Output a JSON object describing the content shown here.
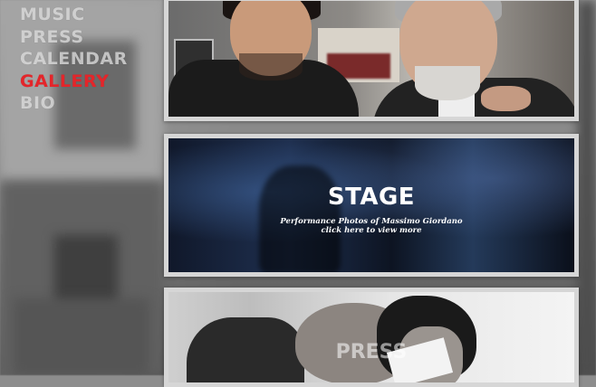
{
  "nav": {
    "items": [
      {
        "label": "MUSIC"
      },
      {
        "label": "PRESS"
      },
      {
        "label": "CALENDAR"
      },
      {
        "label": "GALLERY"
      },
      {
        "label": "BIO"
      }
    ],
    "active_color": "#e4252a"
  },
  "gallery": {
    "stage": {
      "title": "STAGE",
      "subtitle": "Performance Photos of Massimo Giordano",
      "cta": "click here to view more"
    },
    "press": {
      "title": "PRESS"
    }
  }
}
